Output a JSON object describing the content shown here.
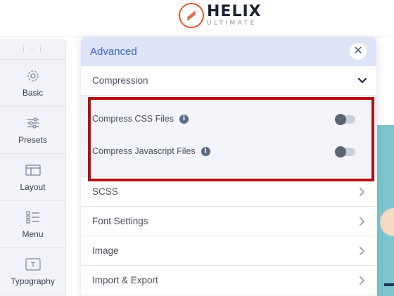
{
  "header": {
    "logo_main": "HELIX",
    "logo_sub": "ULTIMATE",
    "brand_color": "#e0562f"
  },
  "sidebar": {
    "items": [
      {
        "label": "Basic",
        "icon": "gear-icon"
      },
      {
        "label": "Presets",
        "icon": "sliders-icon"
      },
      {
        "label": "Layout",
        "icon": "layout-icon"
      },
      {
        "label": "Menu",
        "icon": "menu-list-icon"
      },
      {
        "label": "Typography",
        "icon": "typography-icon"
      }
    ]
  },
  "panel": {
    "title": "Advanced",
    "accent_color": "#3f63c9",
    "sections": [
      {
        "label": "Compression",
        "expanded": true
      },
      {
        "label": "SCSS",
        "expanded": false
      },
      {
        "label": "Font Settings",
        "expanded": false
      },
      {
        "label": "Image",
        "expanded": false
      },
      {
        "label": "Import & Export",
        "expanded": false
      }
    ],
    "compression_options": [
      {
        "label": "Compress CSS Files",
        "enabled": false
      },
      {
        "label": "Compress Javascript Files",
        "enabled": false
      }
    ]
  },
  "annotation": {
    "highlight_color": "#b01116"
  }
}
